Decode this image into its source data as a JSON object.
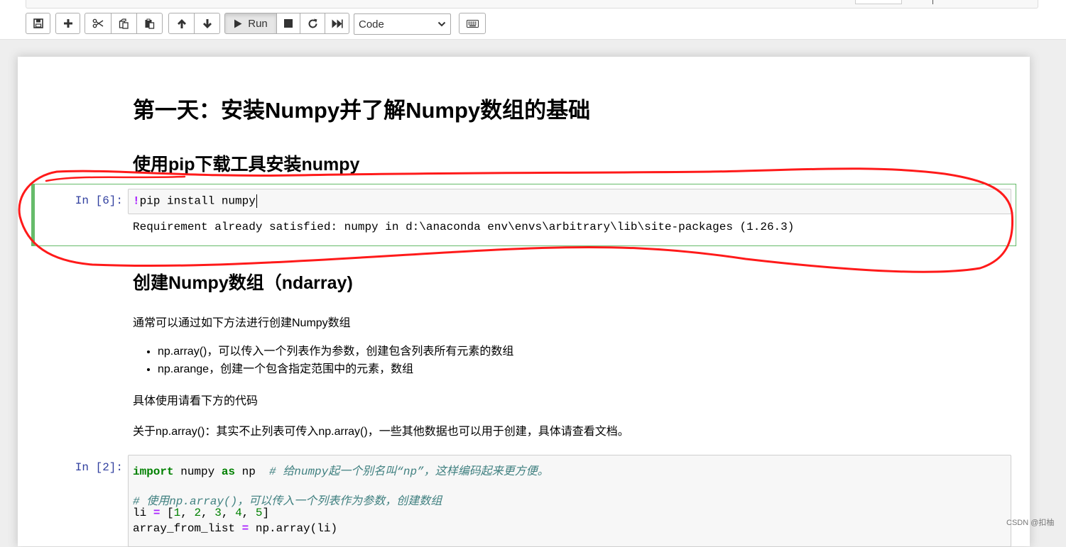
{
  "toolbar": {
    "run_label": "Run",
    "cell_type_select": "Code",
    "icons": [
      "save-icon",
      "plus-icon",
      "cut-icon",
      "copy-icon",
      "paste-icon",
      "arrow-up-icon",
      "arrow-down-icon",
      "play-icon",
      "stop-icon",
      "restart-icon",
      "fast-forward-icon",
      "keyboard-icon"
    ]
  },
  "notebook": {
    "h1": "第一天：安装Numpy并了解Numpy数组的基础",
    "h2_install": "使用pip下载工具安装numpy",
    "cell1": {
      "prompt": "In [6]:",
      "code_bang": "!",
      "code_rest": "pip install numpy",
      "output": "Requirement already satisfied: numpy in d:\\anaconda env\\envs\\arbitrary\\lib\\site-packages (1.26.3)"
    },
    "h2_create": "创建Numpy数组（ndarray)",
    "para1": "通常可以通过如下方法进行创建Numpy数组",
    "bullets": [
      "np.array()，可以传入一个列表作为参数，创建包含列表所有元素的数组",
      "np.arange，创建一个包含指定范围中的元素，数组"
    ],
    "para2": "具体使用请看下方的代码",
    "para3": "关于np.array()：其实不止列表可传入np.array()，一些其他数据也可以用于创建，具体请查看文档。",
    "cell2": {
      "prompt": "In [2]:",
      "l1_kw1": "import",
      "l1_mod": " numpy ",
      "l1_kw2": "as",
      "l1_alias": " np  ",
      "l1_comment": "# 给numpy起一个别名叫“np”，这样编码起来更方便。",
      "l3_comment": "# 使用np.array()，可以传入一个列表作为参数，创建数组",
      "l4_var": "li ",
      "l4_eq": "=",
      "l4_open": " [",
      "l4_n1": "1",
      "l4_n2": "2",
      "l4_n3": "3",
      "l4_n4": "4",
      "l4_n5": "5",
      "l4_sep": ", ",
      "l4_close": "]",
      "l5_var": "array_from_list ",
      "l5_eq": "=",
      "l5_rest": " np.array(li)"
    }
  },
  "watermark": "CSDN @扣柚",
  "colors": {
    "selected_cell_border": "#66bb6a",
    "prompt": "#303f9f",
    "annotation_stroke": "#ff1a1a"
  }
}
